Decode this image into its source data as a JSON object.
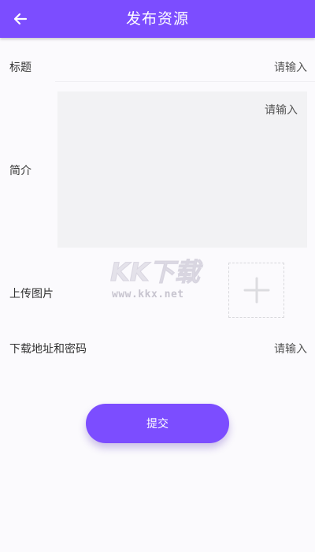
{
  "header": {
    "title": "发布资源",
    "back_icon": "arrow-left-icon"
  },
  "form": {
    "title_label": "标题",
    "title_placeholder": "请输入",
    "intro_label": "简介",
    "intro_placeholder": "请输入",
    "image_label": "上传图片",
    "add_image_icon": "plus-icon",
    "download_label": "下载地址和密码",
    "download_placeholder": "请输入"
  },
  "watermark": {
    "logo_text": "KK下载",
    "url": "www.kkx.net"
  },
  "submit": {
    "label": "提交"
  },
  "colors": {
    "accent": "#7c4dff",
    "background": "#fbfafd",
    "field_bg": "#f2f2f4"
  }
}
